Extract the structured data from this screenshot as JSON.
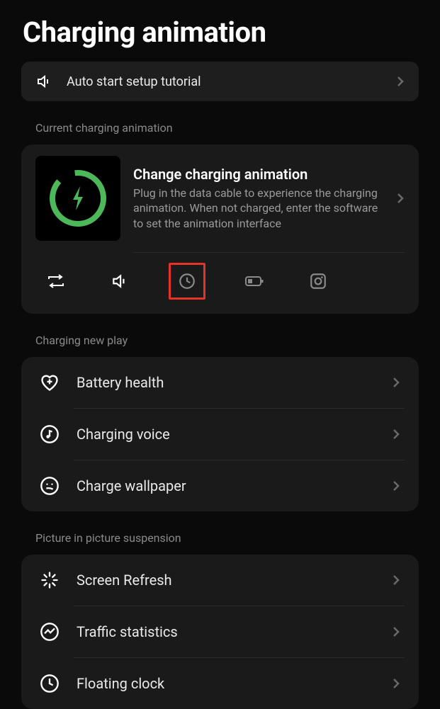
{
  "title": "Charging animation",
  "tutorial": {
    "label": "Auto start setup tutorial"
  },
  "current_section": {
    "label": "Current charging animation",
    "title": "Change charging animation",
    "description": "Plug in the data cable to experience the charging animation. When not charged, enter the software to set the animation interface"
  },
  "toolbar": {
    "items": [
      "loop",
      "sound",
      "clock",
      "battery",
      "camera"
    ],
    "selected_index": 2
  },
  "new_play_section": {
    "label": "Charging new play",
    "items": [
      {
        "icon": "heart-plus",
        "label": "Battery health"
      },
      {
        "icon": "music-note",
        "label": "Charging voice"
      },
      {
        "icon": "face",
        "label": "Charge wallpaper"
      }
    ]
  },
  "pip_section": {
    "label": "Picture in picture suspension",
    "items": [
      {
        "icon": "sparkle",
        "label": "Screen Refresh"
      },
      {
        "icon": "chart",
        "label": "Traffic statistics"
      },
      {
        "icon": "clock-outline",
        "label": "Floating clock"
      }
    ]
  }
}
